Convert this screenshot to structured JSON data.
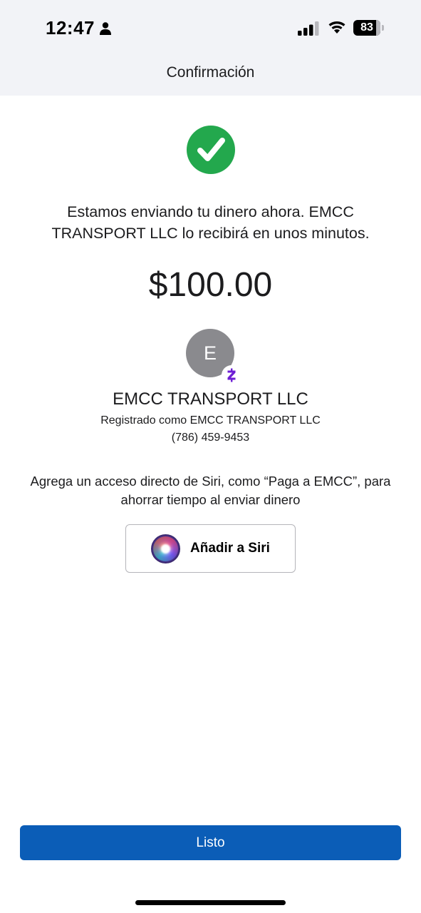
{
  "status_bar": {
    "time": "12:47",
    "battery_level": "83",
    "battery_fraction": 0.83
  },
  "header": {
    "title": "Confirmación"
  },
  "confirmation": {
    "message": "Estamos enviando tu dinero ahora. EMCC TRANSPORT LLC lo recibirá en unos minutos.",
    "amount": "$100.00",
    "success_color": "#23a84d"
  },
  "recipient": {
    "avatar_letter": "E",
    "avatar_color": "#8a8a8e",
    "name": "EMCC TRANSPORT LLC",
    "registered_as": "Registrado como EMCC TRANSPORT LLC",
    "phone": "(786) 459-9453",
    "badge_icon": "zelle-icon",
    "badge_color": "#6d1ed4"
  },
  "siri": {
    "prompt": "Agrega un acceso directo de Siri, como “Paga a EMCC”, para ahorrar tiempo al enviar dinero",
    "button_label": "Añadir a Siri",
    "icon": "siri-icon"
  },
  "footer": {
    "done_label": "Listo",
    "done_color": "#0b5db7"
  }
}
